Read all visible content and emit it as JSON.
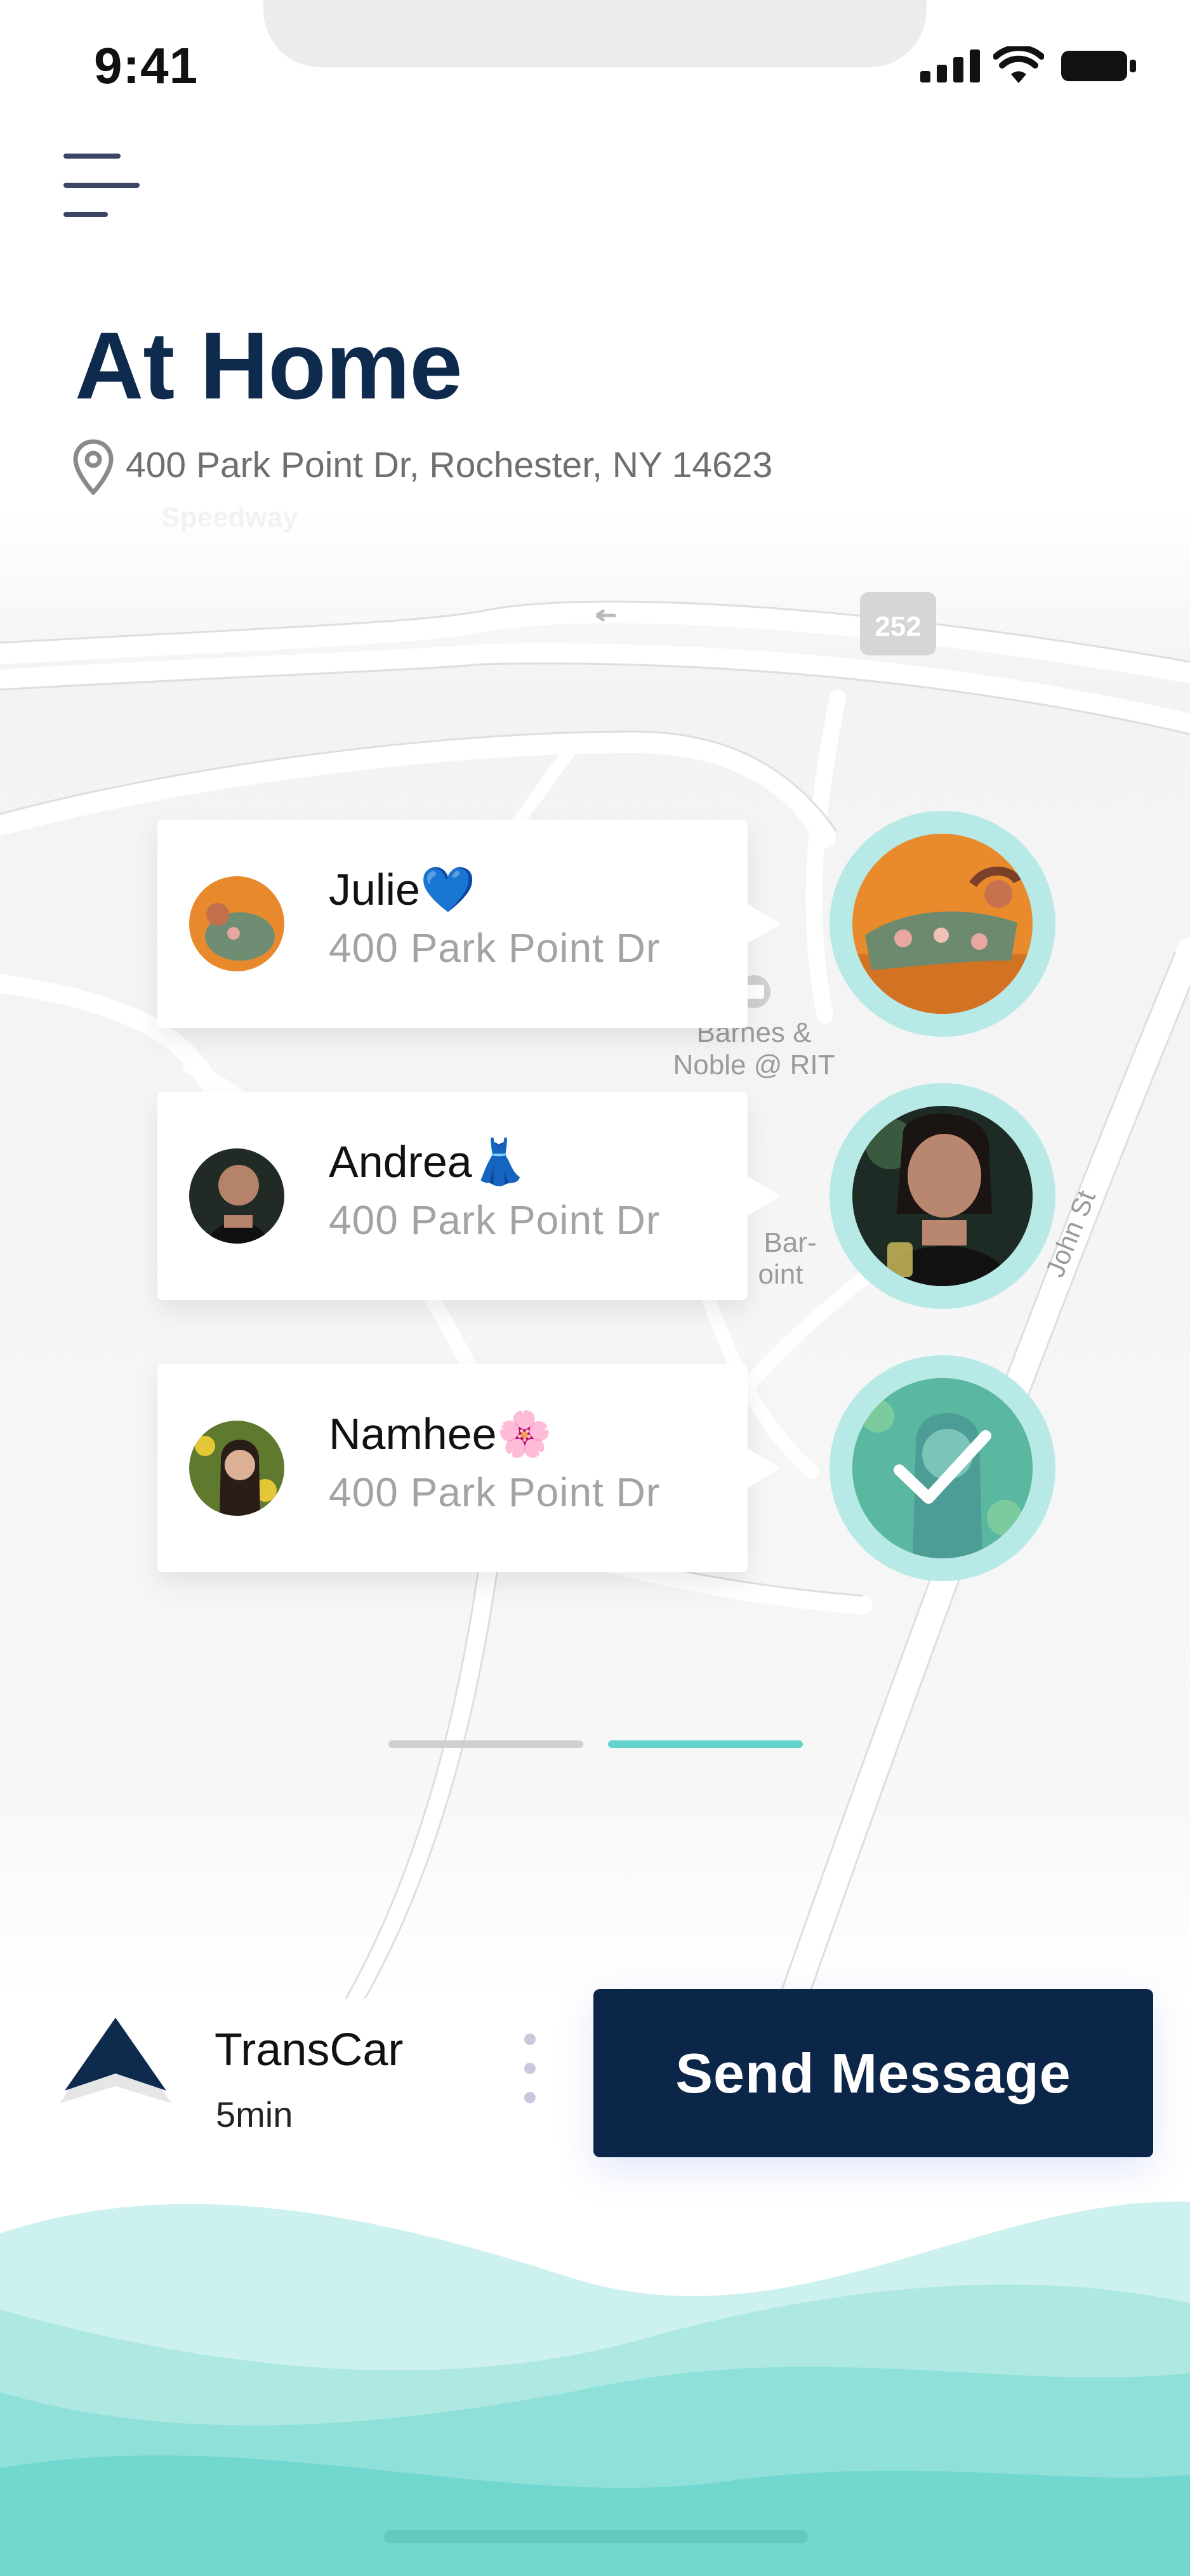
{
  "status_bar": {
    "time": "9:41",
    "icons": [
      "signal-icon",
      "wifi-icon",
      "battery-icon"
    ]
  },
  "header": {
    "menu_icon": "hamburger-menu-icon",
    "title": "At Home",
    "address_icon": "location-pin-icon",
    "address": "400 Park Point Dr, Rochester, NY 14623"
  },
  "map": {
    "labels": {
      "speedway": "Speedway",
      "route_shield": "252",
      "barnes": [
        "Barnes &",
        "Noble @ RIT"
      ],
      "bar_point": [
        "Bar-",
        "oint"
      ],
      "street": "John St"
    }
  },
  "contacts": [
    {
      "name": "Julie💙",
      "address": "400 Park Point Dr",
      "selected": false
    },
    {
      "name": "Andrea👗",
      "address": "400 Park Point Dr",
      "selected": false
    },
    {
      "name": "Namhee🌸",
      "address": "400 Park Point Dr",
      "selected": true
    }
  ],
  "pager": {
    "pages": 2,
    "active_index": 1
  },
  "transport": {
    "icon": "navigation-arrow-icon",
    "name": "TransCar",
    "eta": "5min",
    "more_icon": "vertical-dots-icon"
  },
  "actions": {
    "send_label": "Send Message"
  },
  "colors": {
    "navy": "#0c2649",
    "title": "#0e2a4d",
    "teal_ring": "#b7eae7",
    "teal_accent": "#64d3cb",
    "wave_light": "#bfeeea",
    "wave_dark": "#6fd8d0"
  }
}
